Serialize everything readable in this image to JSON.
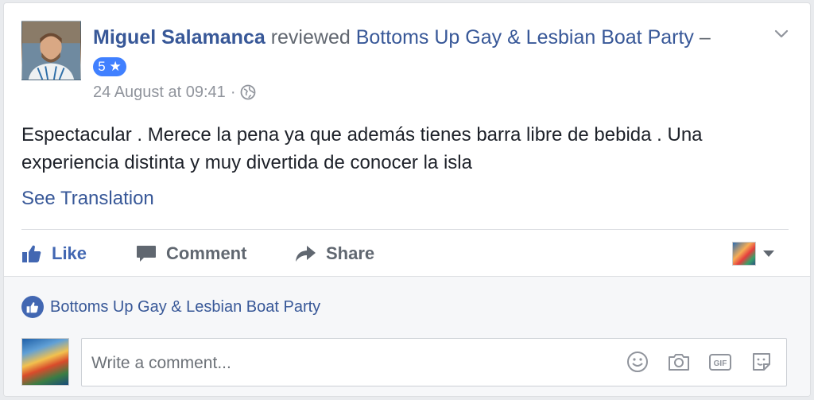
{
  "post": {
    "author": "Miguel Salamanca",
    "verb": "reviewed",
    "page_name": "Bottoms Up Gay & Lesbian Boat Party",
    "dash": "–",
    "rating": "5 ★",
    "timestamp": "24 August at 09:41",
    "separator": "·",
    "text": "Espectacular . Merece la pena ya que además tienes barra libre de bebida . Una experiencia distinta y muy divertida de conocer la isla",
    "see_translation": "See Translation"
  },
  "actions": {
    "like": "Like",
    "comment": "Comment",
    "share": "Share"
  },
  "footer": {
    "liked_by": "Bottoms Up Gay & Lesbian Boat Party",
    "comment_placeholder": "Write a comment..."
  },
  "colors": {
    "link": "#385898",
    "like_blue": "#4267b2",
    "rating_blue": "#4080ff",
    "muted": "#90949c"
  }
}
